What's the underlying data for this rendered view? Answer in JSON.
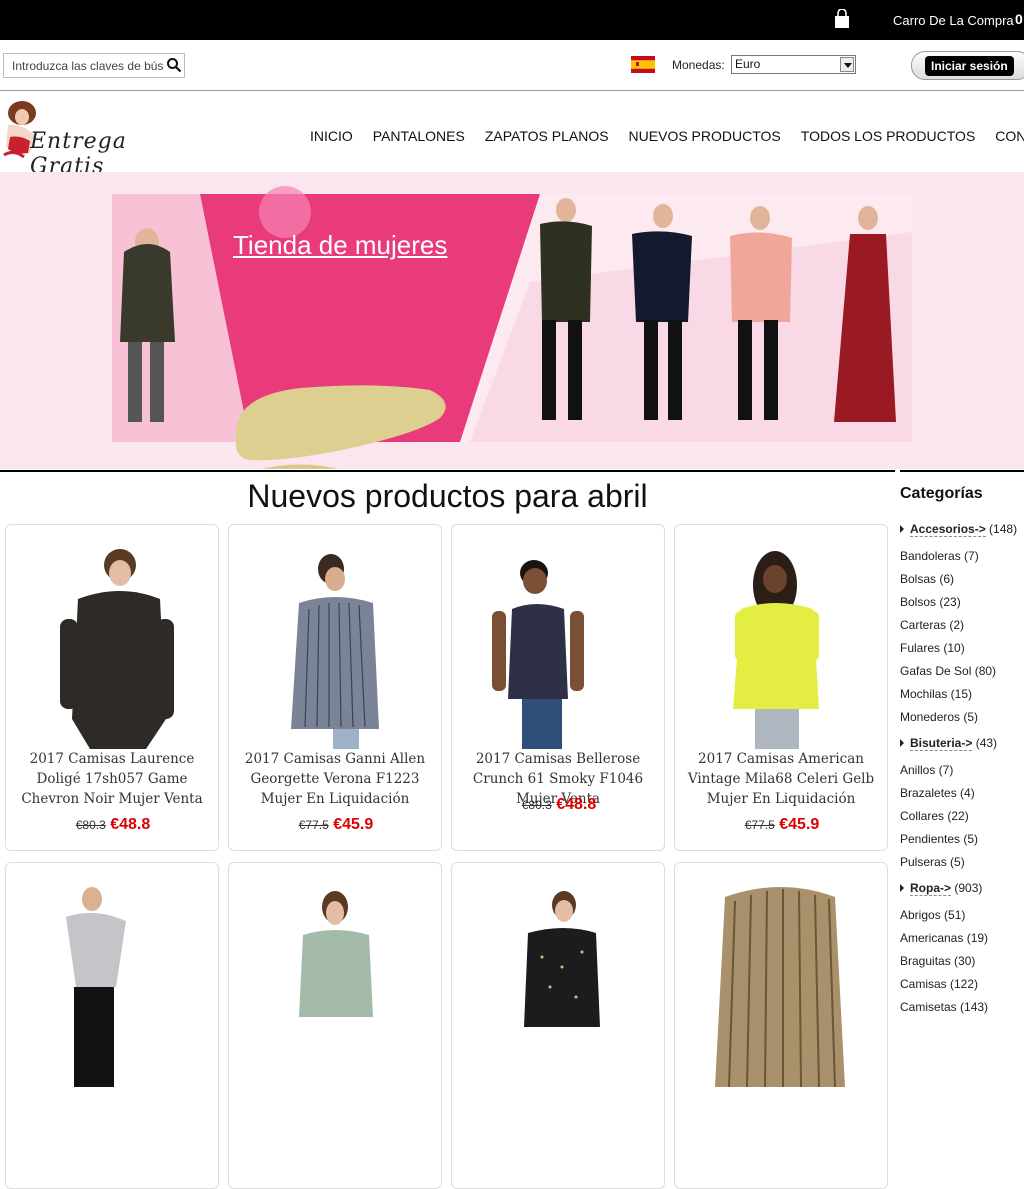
{
  "header": {
    "cart_label": "Carro De La Compra",
    "cart_count": "0",
    "search_placeholder": "Introduzca las claves de búsqueda",
    "currency_label": "Monedas:",
    "currency_selected": "Euro",
    "login_label": "Iniciar sesión"
  },
  "logo": {
    "text": "Entrega Gratis"
  },
  "nav": [
    "INICIO",
    "PANTALONES",
    "ZAPATOS PLANOS",
    "NUEVOS PRODUCTOS",
    "TODOS LOS PRODUCTOS",
    "CONTACTO"
  ],
  "banner": {
    "title": "Tienda de mujeres"
  },
  "main": {
    "section_title": "Nuevos productos para abril",
    "products": [
      {
        "name": "2017 Camisas Laurence Doligé 17sh057 Game Chevron Noir Mujer Venta",
        "old_price": "€80.3",
        "new_price": "€48.8"
      },
      {
        "name": "2017 Camisas Ganni Allen Georgette Verona F1223 Mujer En Liquidación",
        "old_price": "€77.5",
        "new_price": "€45.9"
      },
      {
        "name": "2017 Camisas Bellerose Crunch 61 Smoky F1046 Mujer Venta",
        "old_price": "€80.3",
        "new_price": "€48.8"
      },
      {
        "name": "2017 Camisas American Vintage Mila68 Celeri Gelb Mujer En Liquidación",
        "old_price": "€77.5",
        "new_price": "€45.9"
      }
    ]
  },
  "sidebar": {
    "title": "Categorías",
    "groups": [
      {
        "label": "Accesorios->",
        "count": "(148)",
        "items": [
          "Bandoleras (7)",
          "Bolsas (6)",
          "Bolsos (23)",
          "Carteras (2)",
          "Fulares (10)",
          "Gafas De Sol (80)",
          "Mochilas (15)",
          "Monederos (5)"
        ]
      },
      {
        "label": "Bisuteria->",
        "count": "(43)",
        "items": [
          "Anillos (7)",
          "Brazaletes (4)",
          "Collares (22)",
          "Pendientes (5)",
          "Pulseras (5)"
        ]
      },
      {
        "label": "Ropa->",
        "count": "(903)",
        "items": [
          "Abrigos (51)",
          "Americanas (19)",
          "Braguitas (30)",
          "Camisas (122)",
          "Camisetas (143)"
        ]
      }
    ]
  }
}
